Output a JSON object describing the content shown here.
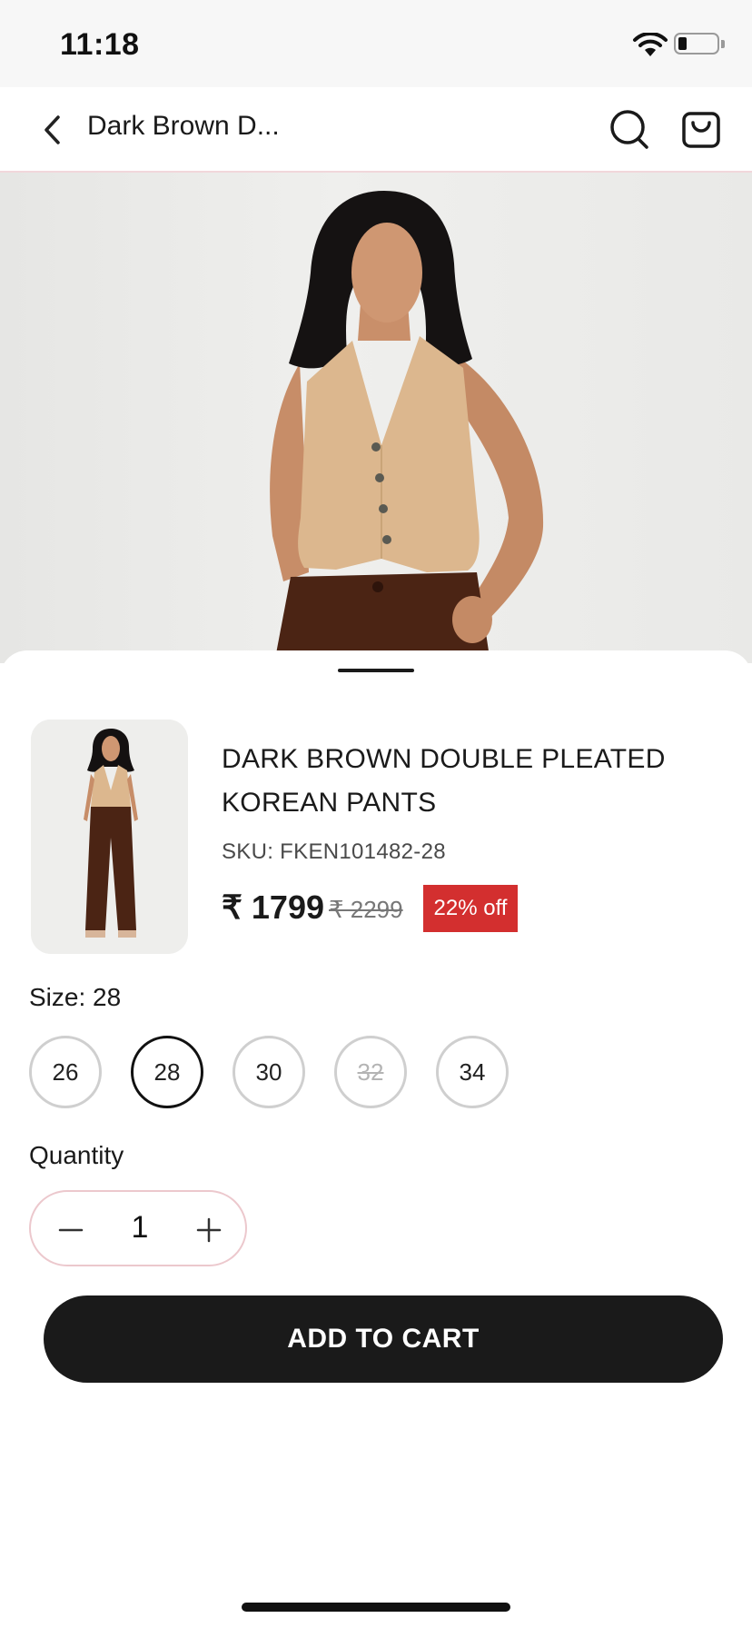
{
  "status_bar": {
    "time": "11:18"
  },
  "nav": {
    "title": "Dark Brown D...",
    "back_icon": "chevron-left-icon",
    "search_icon": "search-icon",
    "cart_icon": "shopping-bag-icon"
  },
  "hero": {
    "alt": "Model wearing beige waistcoat and dark brown pleated pants"
  },
  "product": {
    "name": "DARK BROWN DOUBLE PLEATED KOREAN PANTS",
    "sku": "SKU: FKEN101482-28",
    "price": "₹ 1799",
    "mrp": "₹ 2299",
    "discount": "22% off",
    "thumbnail_alt": "Dark brown double pleated Korean pants full view"
  },
  "sizes": {
    "label": "Size: 28",
    "options": [
      {
        "label": "26",
        "state": "available"
      },
      {
        "label": "28",
        "state": "selected"
      },
      {
        "label": "30",
        "state": "available"
      },
      {
        "label": "32",
        "state": "unavailable"
      },
      {
        "label": "34",
        "state": "available"
      }
    ]
  },
  "quantity": {
    "label": "Quantity",
    "value": "1"
  },
  "cta": {
    "add_to_cart": "ADD TO CART"
  },
  "colors": {
    "accent": "#1a1a1a",
    "discount": "#d32f2f",
    "vest": "#dcb78e",
    "pants": "#4b2414"
  }
}
